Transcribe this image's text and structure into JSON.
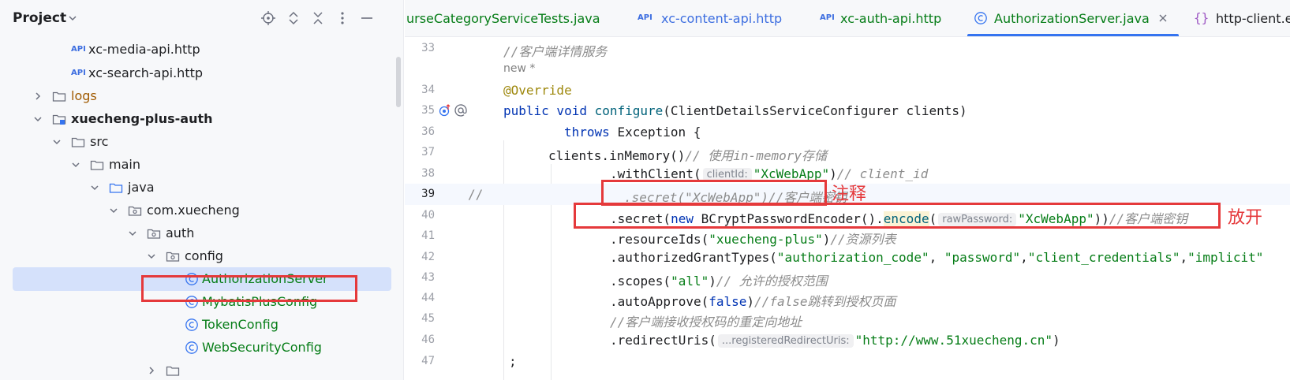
{
  "project_panel": {
    "title": "Project",
    "tree": [
      {
        "label": "xc-media-api.http",
        "type": "http"
      },
      {
        "label": "xc-search-api.http",
        "type": "http"
      },
      {
        "label": "logs",
        "type": "folder"
      },
      {
        "label": "xuecheng-plus-auth",
        "type": "module"
      },
      {
        "label": "src",
        "type": "folder"
      },
      {
        "label": "main",
        "type": "folder"
      },
      {
        "label": "java",
        "type": "folder"
      },
      {
        "label": "com.xuecheng",
        "type": "package"
      },
      {
        "label": "auth",
        "type": "package"
      },
      {
        "label": "config",
        "type": "package"
      },
      {
        "label": "AuthorizationServer",
        "type": "class"
      },
      {
        "label": "MybatisPlusConfig",
        "type": "class"
      },
      {
        "label": "TokenConfig",
        "type": "class"
      },
      {
        "label": "WebSecurityConfig",
        "type": "class"
      }
    ]
  },
  "tabs": [
    {
      "label": "urseCategoryServiceTests.java"
    },
    {
      "label": "xc-content-api.http",
      "icon": "API"
    },
    {
      "label": "xc-auth-api.http",
      "icon": "API"
    },
    {
      "label": "AuthorizationServer.java"
    },
    {
      "label": "http-client.en"
    }
  ],
  "editor": {
    "line_numbers": [
      "33",
      "34",
      "35",
      "36",
      "37",
      "38",
      "39",
      "40",
      "41",
      "42",
      "43",
      "44",
      "45",
      "46",
      "47"
    ],
    "l33": "//客户端详情服务",
    "author": "new *",
    "l34": "@Override",
    "l35": {
      "kw": "public void ",
      "fn": "configure",
      "rest": "(ClientDetailsServiceConfigurer clients)"
    },
    "l36": {
      "kw": "throws ",
      "rest": "Exception {"
    },
    "l37": {
      "code": "clients.inMemory()",
      "cmt": "// 使用in-memory存储"
    },
    "l38": {
      "code": ".withClient(",
      "hint": "clientId:",
      "str": "\"XcWebApp\"",
      "close": ")",
      "cmt": "// client_id"
    },
    "l39": {
      "prefix": "//",
      "cmt": ".secret(\"XcWebApp\")//客户端密钥"
    },
    "l40": {
      "a": ".secret(",
      "kw": "new ",
      "b": "BCryptPasswordEncoder().",
      "fn": "encode",
      "c": "(",
      "hint": "rawPassword:",
      "str": "\"XcWebApp\"",
      "close": "))",
      "cmt": "//客户端密钥"
    },
    "l41": {
      "code": ".resourceIds(",
      "str": "\"xuecheng-plus\"",
      "close": ")",
      "cmt": "//资源列表"
    },
    "l42": {
      "code": ".authorizedGrantTypes(",
      "s1": "\"authorization_code\"",
      "s2": "\"password\"",
      "s3": "\"client_credentials\"",
      "s4": "\"implicit\""
    },
    "l43": {
      "code": ".scopes(",
      "str": "\"all\"",
      "close": ")",
      "cmt": "// 允许的授权范围"
    },
    "l44": {
      "code": ".autoApprove(",
      "kw": "false",
      "close": ")",
      "cmt": "//false跳转到授权页面"
    },
    "l45": {
      "cmt": "//客户端接收授权码的重定向地址"
    },
    "l46": {
      "code": ".redirectUris(",
      "hint": "...registeredRedirectUris:",
      "str": "\"http://www.51xuecheng.cn\"",
      "close": ")"
    },
    "l47": {
      "code": ";"
    }
  },
  "annotations": {
    "comment_label": "注释",
    "uncomment_label": "放开"
  },
  "colors": {
    "annotation_red": "#e5393b",
    "selection_blue": "#d5e1fb",
    "string_green": "#067d17",
    "keyword_blue": "#0033b3"
  }
}
